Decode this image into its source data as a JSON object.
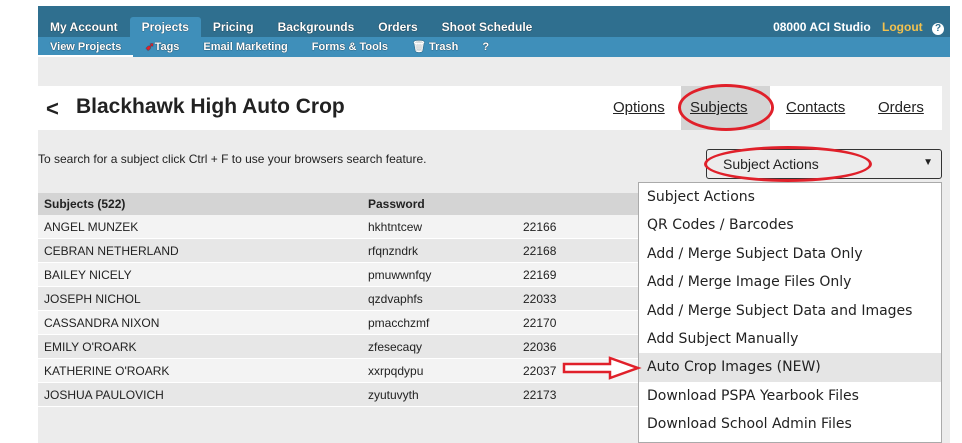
{
  "topnav": {
    "items": [
      "My Account",
      "Projects",
      "Pricing",
      "Backgrounds",
      "Orders",
      "Shoot Schedule"
    ],
    "account": "08000 ACI Studio",
    "logout": "Logout",
    "help": "?"
  },
  "subnav": {
    "items": [
      "View Projects",
      "Tags",
      "Email Marketing",
      "Forms & Tools",
      "Trash",
      "?"
    ]
  },
  "project": {
    "back": "<",
    "title": "Blackhawk High Auto Crop",
    "links": [
      "Options",
      "Subjects",
      "Contacts",
      "Orders"
    ]
  },
  "search_hint": "To search for a subject click Ctrl + F to use your browsers search feature.",
  "actions": {
    "label": "Subject Actions",
    "options": [
      "Subject Actions",
      "QR Codes / Barcodes",
      "Add / Merge Subject Data Only",
      "Add / Merge Image Files Only",
      "Add / Merge Subject Data and Images",
      "Add Subject Manually",
      "Auto Crop Images (NEW)",
      "Download PSPA Yearbook Files",
      "Download School Admin Files"
    ]
  },
  "table": {
    "headers": [
      "Subjects (522)",
      "Password"
    ],
    "rows": [
      [
        "ANGEL MUNZEK",
        "hkhtntcew",
        "22166"
      ],
      [
        "CEBRAN NETHERLAND",
        "rfqnzndrk",
        "22168"
      ],
      [
        "BAILEY NICELY",
        "pmuwwnfqy",
        "22169"
      ],
      [
        "JOSEPH NICHOL",
        "qzdvaphfs",
        "22033"
      ],
      [
        "CASSANDRA NIXON",
        "pmacchzmf",
        "22170"
      ],
      [
        "EMILY O'ROARK",
        "zfesecaqy",
        "22036"
      ],
      [
        "KATHERINE O'ROARK",
        "xxrpqdypu",
        "22037"
      ],
      [
        "JOSHUA PAULOVICH",
        "zyutuvyth",
        "22173"
      ]
    ]
  },
  "colors": {
    "nav": "#2f6f8f",
    "nav_active": "#3f8fba",
    "annotation": "#e0202a",
    "logout": "#f2c14e"
  }
}
